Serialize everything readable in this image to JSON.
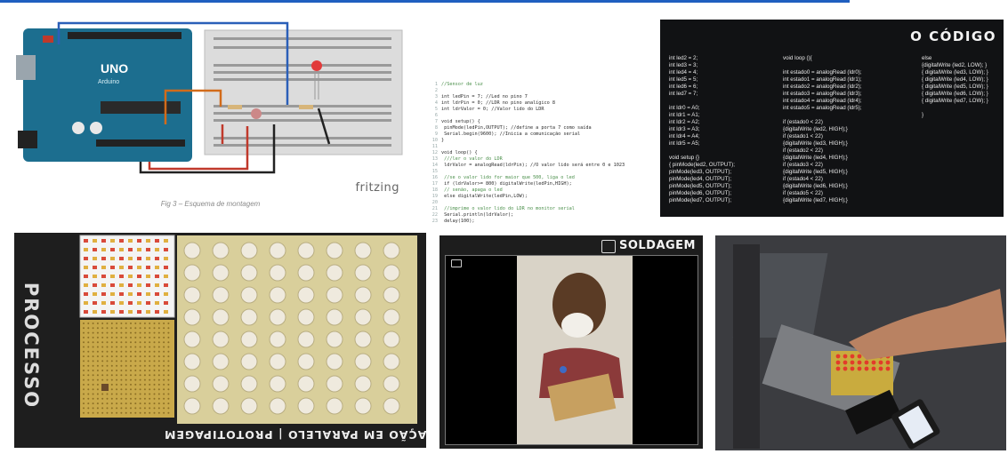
{
  "fritzing": {
    "board_label": "UNO",
    "board_brand": "Arduino",
    "logo": "fritzing",
    "caption": "Fig 3 – Esquema de montagem"
  },
  "code_listing": {
    "lines": [
      {
        "n": "1",
        "t": "//Sensor de luz",
        "c": true
      },
      {
        "n": "2",
        "t": "",
        "c": false
      },
      {
        "n": "3",
        "t": "int ledPin = 7; //Led no pino 7",
        "c": false
      },
      {
        "n": "4",
        "t": "int ldrPin = 0; //LDR no pino analígico 8",
        "c": false
      },
      {
        "n": "5",
        "t": "int ldrValor = 0; //Valor lido do LDR",
        "c": false
      },
      {
        "n": "6",
        "t": "",
        "c": false
      },
      {
        "n": "7",
        "t": "void setup() {",
        "c": false
      },
      {
        "n": "8",
        "t": " pinMode(ledPin,OUTPUT); //define a porta 7 como saída",
        "c": false
      },
      {
        "n": "9",
        "t": " Serial.begin(9600); //Inicia a comunicação serial",
        "c": false
      },
      {
        "n": "10",
        "t": "}",
        "c": false
      },
      {
        "n": "11",
        "t": "",
        "c": false
      },
      {
        "n": "12",
        "t": "void loop() {",
        "c": false
      },
      {
        "n": "13",
        "t": " ///ler o valor do LDR",
        "c": true
      },
      {
        "n": "14",
        "t": " ldrValor = analogRead(ldrPin); //O valor lido será entre 0 e 1023",
        "c": false
      },
      {
        "n": "15",
        "t": "",
        "c": false
      },
      {
        "n": "16",
        "t": " //se o valor lido for maior que 500, liga o led",
        "c": true
      },
      {
        "n": "17",
        "t": " if (ldrValor>= 800) digitalWrite(ledPin,HIGH);",
        "c": false
      },
      {
        "n": "18",
        "t": " // senão, apaga o led",
        "c": true
      },
      {
        "n": "19",
        "t": " else digitalWrite(ledPin,LOW);",
        "c": false
      },
      {
        "n": "20",
        "t": "",
        "c": false
      },
      {
        "n": "21",
        "t": " //imprime o valor lido do LDR no monitor serial",
        "c": true
      },
      {
        "n": "22",
        "t": " Serial.println(ldrValor);",
        "c": false
      },
      {
        "n": "23",
        "t": " delay(100);",
        "c": false
      },
      {
        "n": "24",
        "t": "}",
        "c": false
      }
    ]
  },
  "o_codigo": {
    "title": "O CÓDIGO",
    "col1": "int led2 = 2;\nint led3 = 3;\nint led4 = 4;\nint led5 = 5;\nint led6 = 6;\nint led7 = 7;\n\nint ldr0 = A0;\nint ldr1 = A1;\nint ldr2 = A2;\nint ldr3 = A3;\nint ldr4 = A4;\nint ldr5 = A5;\n\nvoid setup {}\n{ pinMode(led2, OUTPUT);\npinMode(led3, OUTPUT);\npinMode(led4, OUTPUT);\npinMode(led5, OUTPUT);\npinMode(led6, OUTPUT);\npinMode(led7, OUTPUT);",
    "col2": "void loop (){\n\nint estado0 = analogRead (ldr0);\nint estado1 = analogRead (ldr1);\nint estado2 = analogRead (ldr2);\nint estado3 = analogRead (ldr3);\nint estado4 = analogRead (ldr4);\nint estado5 = analogRead (ldr5);\n\nif (estado0 < 22)\n{digitalWrite (led2, HIGH);}\nif (estado1 < 22)\n{digitalWrite (led3, HIGH);}\nif (estado2 < 22)\n{digitalWrite (led4, HIGH);}\nif (estado3 < 22)\n{digitalWrite (led5, HIGH);}\nif (estado4 < 22)\n{digitalWrite (led6, HIGH);}\nif (estado5 < 22)\n{digitalWrite (led7, HIGH);}",
    "col3": "else\n{digitalWrite (led2, LOW); }\n{ digitalWrite (led3, LOW); }\n{ digitalWrite (led4, LOW); }\n{ digitalWrite (led5, LOW); }\n{ digitalWrite (led6, LOW); }\n{ digitalWrite (led7, LOW); }\n\n}"
  },
  "processo": {
    "vertical_title": "PROCESSO",
    "footer": "LIGAÇÃO EM PARALELO | PROTOTIPAGEM"
  },
  "soldagem": {
    "title": "SOLDAGEM"
  },
  "colors": {
    "accent_blue": "#1f5fc0",
    "dark_panel": "#111214",
    "pcb_yellow": "#c9a94a"
  }
}
